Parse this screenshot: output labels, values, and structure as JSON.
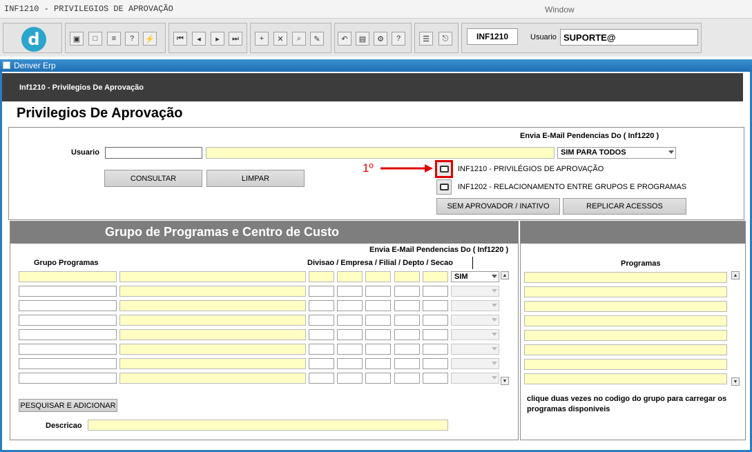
{
  "window": {
    "title": "INF1210 - PRIVILEGIOS DE APROVAÇÃO",
    "menu": "Window"
  },
  "toolbar": {
    "logo_letter": "d",
    "form_code": "INF1210",
    "user_label": "Usuario",
    "user_value": "SUPORTE@"
  },
  "app": {
    "name": "Denver Erp",
    "header": "Inf1210 - Privilegios De Aprovação",
    "page_title": "Privilegios De Aprovação"
  },
  "top_panel": {
    "email_header": "Envia E-Mail Pendencias Do ( Inf1220 )",
    "usuario_label": "Usuario",
    "usuario_code": "",
    "usuario_name": "",
    "email_select": "SIM PARA TODOS",
    "consultar": "CONSULTAR",
    "limpar": "LIMPAR",
    "annotation": "1º",
    "report1": "INF1210 - PRIVILÉGIOS DE APROVAÇÃO",
    "report2": "INF1202 - RELACIONAMENTO ENTRE GRUPOS E PROGRAMAS",
    "sem_aprovador": "SEM APROVADOR / INATIVO",
    "replicar": "REPLICAR ACESSOS"
  },
  "grupo_panel": {
    "title": "Grupo de Programas e Centro de Custo",
    "email_header": "Envia E-Mail Pendencias Do ( Inf1220 )",
    "col_grupo": "Grupo Programas",
    "col_divisao": "Divisao / Empresa / Filial / Depto / Secao",
    "first_row_select": "SIM",
    "pesquisar": "PESQUISAR E ADICIONAR",
    "descricao_label": "Descricao"
  },
  "programas_panel": {
    "col_programas": "Programas",
    "hint": "clique duas vezes no codigo do grupo para carregar os programas disponiveis"
  },
  "colors": {
    "accent": "#2a7cc0",
    "highlight_red": "#e00000",
    "field_yellow": "#ffffc4"
  }
}
